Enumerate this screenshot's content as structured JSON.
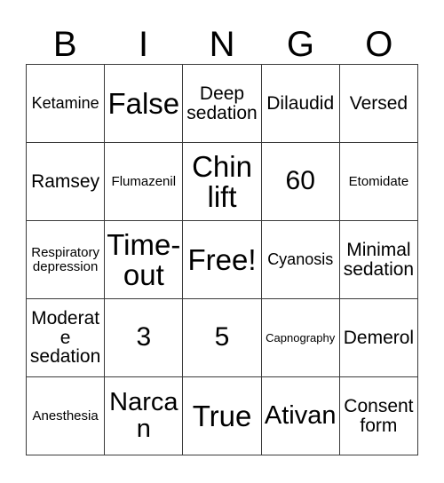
{
  "card": {
    "title_letters": [
      "B",
      "I",
      "N",
      "G",
      "O"
    ],
    "border_color": "#3a3a3a",
    "background_color": "#ffffff",
    "text_color": "#000000",
    "columns": 5,
    "rows": 5,
    "free_space": "Free!",
    "cells": [
      [
        {
          "text": "Ketamine",
          "size": "s"
        },
        {
          "text": "False",
          "size": "xxl"
        },
        {
          "text": "Deep sedation",
          "size": "m"
        },
        {
          "text": "Dilaudid",
          "size": "m"
        },
        {
          "text": "Versed",
          "size": "m"
        }
      ],
      [
        {
          "text": "Ramsey",
          "size": "m"
        },
        {
          "text": "Flumazenil",
          "size": "xs"
        },
        {
          "text": "Chin lift",
          "size": "xxl"
        },
        {
          "text": "60",
          "size": "xl"
        },
        {
          "text": "Etomidate",
          "size": "xs"
        }
      ],
      [
        {
          "text": "Respiratory depression",
          "size": "xs"
        },
        {
          "text": "Time-out",
          "size": "xxl"
        },
        {
          "text": "Free!",
          "size": "xxl"
        },
        {
          "text": "Cyanosis",
          "size": "s"
        },
        {
          "text": "Minimal sedation",
          "size": "m"
        }
      ],
      [
        {
          "text": "Moderate sedation",
          "size": "m"
        },
        {
          "text": "3",
          "size": "xl"
        },
        {
          "text": "5",
          "size": "xl"
        },
        {
          "text": "Capnography",
          "size": "xxs"
        },
        {
          "text": "Demerol",
          "size": "m"
        }
      ],
      [
        {
          "text": "Anesthesia",
          "size": "xs"
        },
        {
          "text": "Narcan",
          "size": "l"
        },
        {
          "text": "True",
          "size": "xxl"
        },
        {
          "text": "Ativan",
          "size": "l"
        },
        {
          "text": "Consent form",
          "size": "m"
        }
      ]
    ]
  }
}
